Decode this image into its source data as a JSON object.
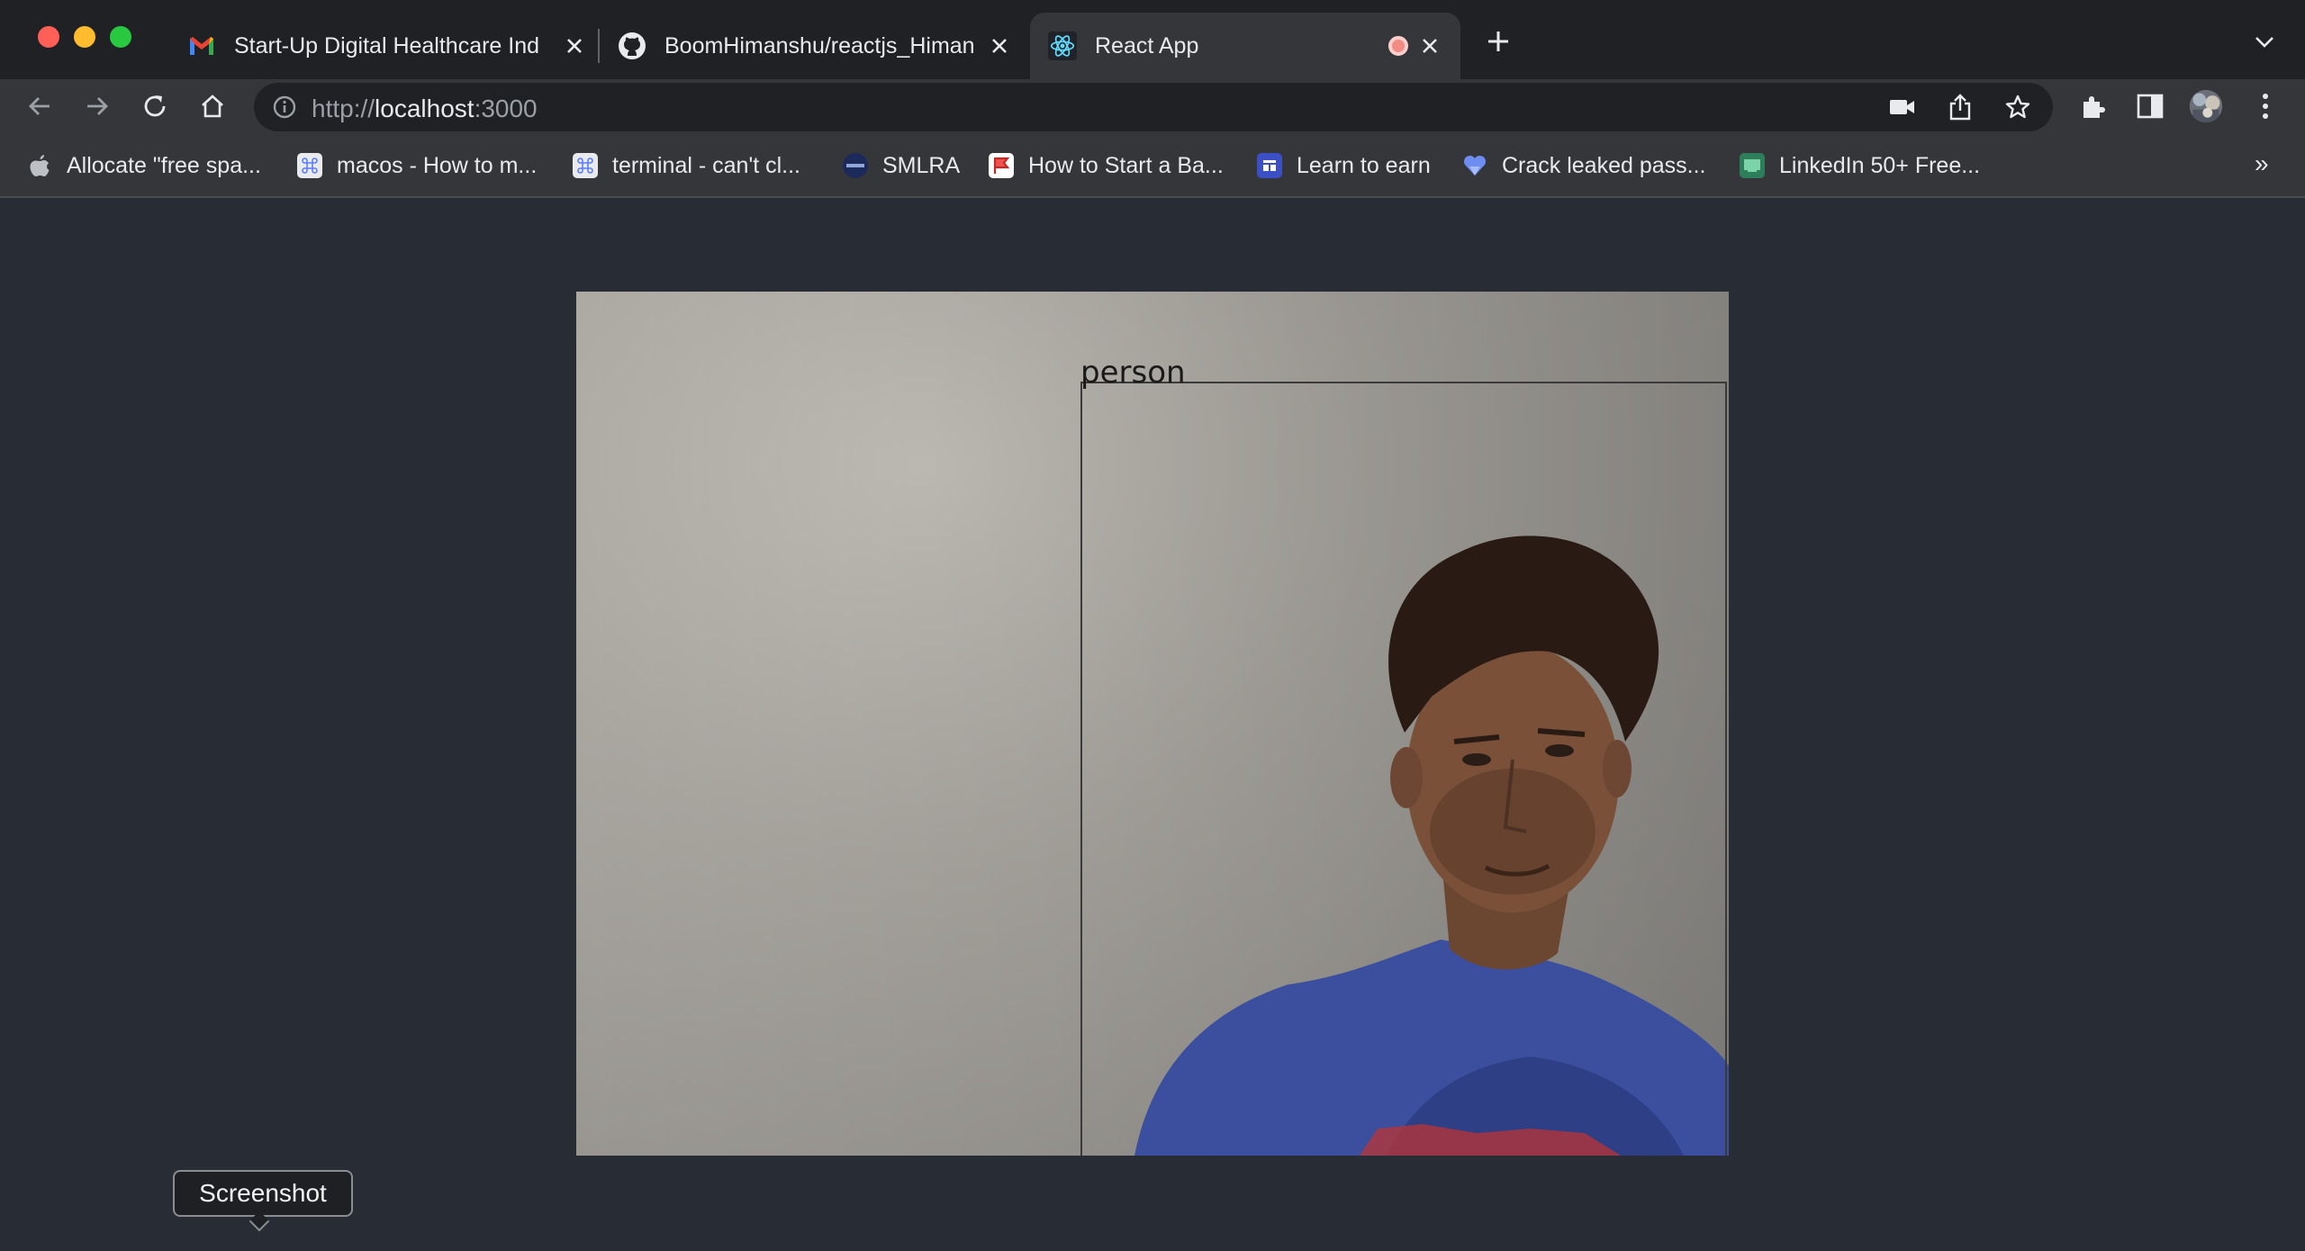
{
  "window": {
    "controls": [
      "close",
      "minimize",
      "zoom"
    ]
  },
  "tabs": [
    {
      "title": "Start-Up Digital Healthcare Ind",
      "icon": "gmail-icon",
      "active": false
    },
    {
      "title": "BoomHimanshu/reactjs_Himan",
      "icon": "github-icon",
      "active": false
    },
    {
      "title": "React App",
      "icon": "react-icon",
      "active": true,
      "recording": true
    }
  ],
  "toolbar": {
    "url_scheme": "http://",
    "url_host": "localhost",
    "url_port": ":3000"
  },
  "bookmarks": [
    {
      "label": "Allocate \"free spa...",
      "icon": "apple-icon"
    },
    {
      "label": "macos - How to m...",
      "icon": "command-icon"
    },
    {
      "label": "terminal - can't cl...",
      "icon": "command-icon"
    },
    {
      "label": "SMLRA",
      "icon": "smlra-icon"
    },
    {
      "label": "How to Start a Ba...",
      "icon": "flag-icon"
    },
    {
      "label": "Learn to earn",
      "icon": "grid-icon"
    },
    {
      "label": "Crack leaked pass...",
      "icon": "heart-icon"
    },
    {
      "label": "LinkedIn 50+ Free...",
      "icon": "course-icon"
    }
  ],
  "bookmarks_more": "»",
  "content": {
    "detection_label": "person"
  },
  "tooltip": {
    "text": "Screenshot"
  },
  "colors": {
    "page_bg": "#282c34",
    "tab_strip_bg": "#202124",
    "toolbar_bg": "#35363a",
    "bbox_stroke": "#3a3a3a"
  }
}
